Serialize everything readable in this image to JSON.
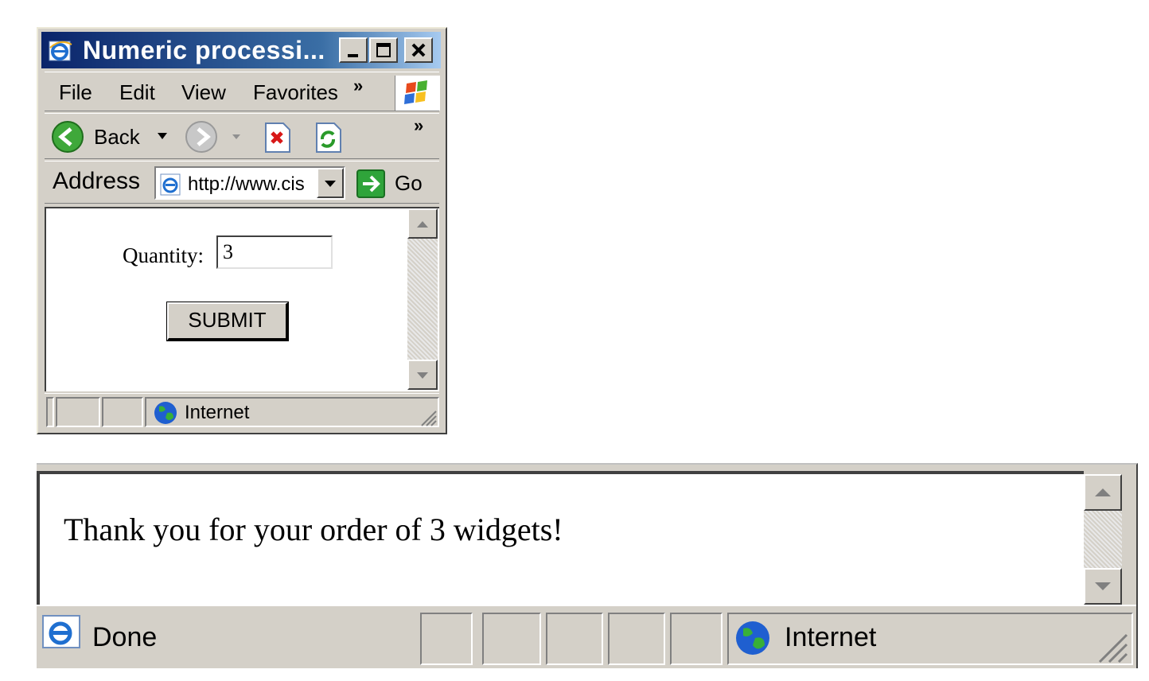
{
  "window1": {
    "title": "Numeric processi...",
    "menu": {
      "file": "File",
      "edit": "Edit",
      "view": "View",
      "favorites": "Favorites",
      "more": "»"
    },
    "toolbar": {
      "back_label": "Back",
      "more": "»"
    },
    "address": {
      "label": "Address",
      "url": "http://www.cis",
      "go_label": "Go"
    },
    "form": {
      "quantity_label": "Quantity:",
      "quantity_value": "3",
      "submit_label": "SUBMIT"
    },
    "status": {
      "zone": "Internet"
    }
  },
  "window2": {
    "message": "Thank you for your order of 3 widgets!",
    "status": {
      "text": "Done",
      "zone": "Internet"
    }
  },
  "colors": {
    "titlebar_start": "#0a246a",
    "titlebar_end": "#a6caf0",
    "chrome": "#d4d0c8"
  }
}
